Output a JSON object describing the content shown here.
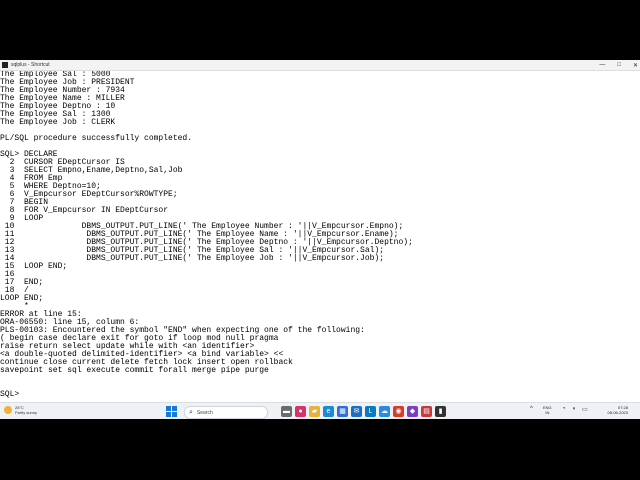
{
  "window": {
    "title": "sqlplus - Shortcut",
    "minimize": "—",
    "maximize": "□",
    "close": "✕"
  },
  "console_lines": [
    "The Employee Sal : 5000",
    "The Employee Job : PRESIDENT",
    "The Employee Number : 7934",
    "The Employee Name : MILLER",
    "The Employee Deptno : 10",
    "The Employee Sal : 1300",
    "The Employee Job : CLERK",
    "",
    "PL/SQL procedure successfully completed.",
    "",
    "SQL> DECLARE",
    "  2  CURSOR EDeptCursor IS",
    "  3  SELECT Empno,Ename,Deptno,Sal,Job",
    "  4  FROM Emp",
    "  5  WHERE Deptno=10;",
    "  6  V_Empcursor EDeptCursor%ROWTYPE;",
    "  7  BEGIN",
    "  8  FOR V_Empcursor IN EDeptCursor",
    "  9  LOOP",
    " 10              DBMS_OUTPUT.PUT_LINE(' The Employee Number : '||V_Empcursor.Empno);",
    " 11               DBMS_OUTPUT.PUT_LINE(' The Employee Name : '||V_Empcursor.Ename);",
    " 12               DBMS_OUTPUT.PUT_LINE(' The Employee Deptno : '||V_Empcursor.Deptno);",
    " 13               DBMS_OUTPUT.PUT_LINE(' The Employee Sal : '||V_Empcursor.Sal);",
    " 14               DBMS_OUTPUT.PUT_LINE(' The Employee Job : '||V_Empcursor.Job);",
    " 15  LOOP END;",
    " 16",
    " 17  END;",
    " 18  /",
    "LOOP END;",
    "     *",
    "ERROR at line 15:",
    "ORA-06550: line 15, column 6:",
    "PLS-00103: Encountered the symbol \"END\" when expecting one of the following:",
    "( begin case declare exit for goto if loop mod null pragma",
    "raise return select update while with <an identifier>",
    "<a double-quoted delimited-identifier> <a bind variable> <<",
    "continue close current delete fetch lock insert open rollback",
    "savepoint set sql execute commit forall merge pipe purge",
    "",
    "",
    "SQL>"
  ],
  "taskbar": {
    "weather_temp": "28°C",
    "weather_desc": "Partly sunny",
    "search_placeholder": "Search",
    "search_icon": "search-icon",
    "apps": [
      {
        "name": "file-manager-icon",
        "glyph": "▬",
        "color": "#6b6b6b"
      },
      {
        "name": "camera-icon",
        "glyph": "●",
        "color": "#d6336c"
      },
      {
        "name": "folder-icon",
        "glyph": "▰",
        "color": "#e8b23a"
      },
      {
        "name": "edge-icon",
        "glyph": "e",
        "color": "#1c8ad6"
      },
      {
        "name": "store-icon",
        "glyph": "▦",
        "color": "#2f6fd6"
      },
      {
        "name": "mail-icon",
        "glyph": "✉",
        "color": "#1a6ec4"
      },
      {
        "name": "lens-icon",
        "glyph": "L",
        "color": "#0b7bbd"
      },
      {
        "name": "cloud-icon",
        "glyph": "☁",
        "color": "#2a8be0"
      },
      {
        "name": "chrome-icon",
        "glyph": "◉",
        "color": "#d93b2b"
      },
      {
        "name": "notes-icon",
        "glyph": "◆",
        "color": "#7b3fc4"
      },
      {
        "name": "database-icon",
        "glyph": "▤",
        "color": "#c43b3b"
      },
      {
        "name": "terminal-icon",
        "glyph": "▮",
        "color": "#333333"
      }
    ],
    "tray_chevron": "^",
    "lang_line1": "ENG",
    "lang_line2": "IN",
    "time": "07:28",
    "date": "08-06-2023"
  }
}
